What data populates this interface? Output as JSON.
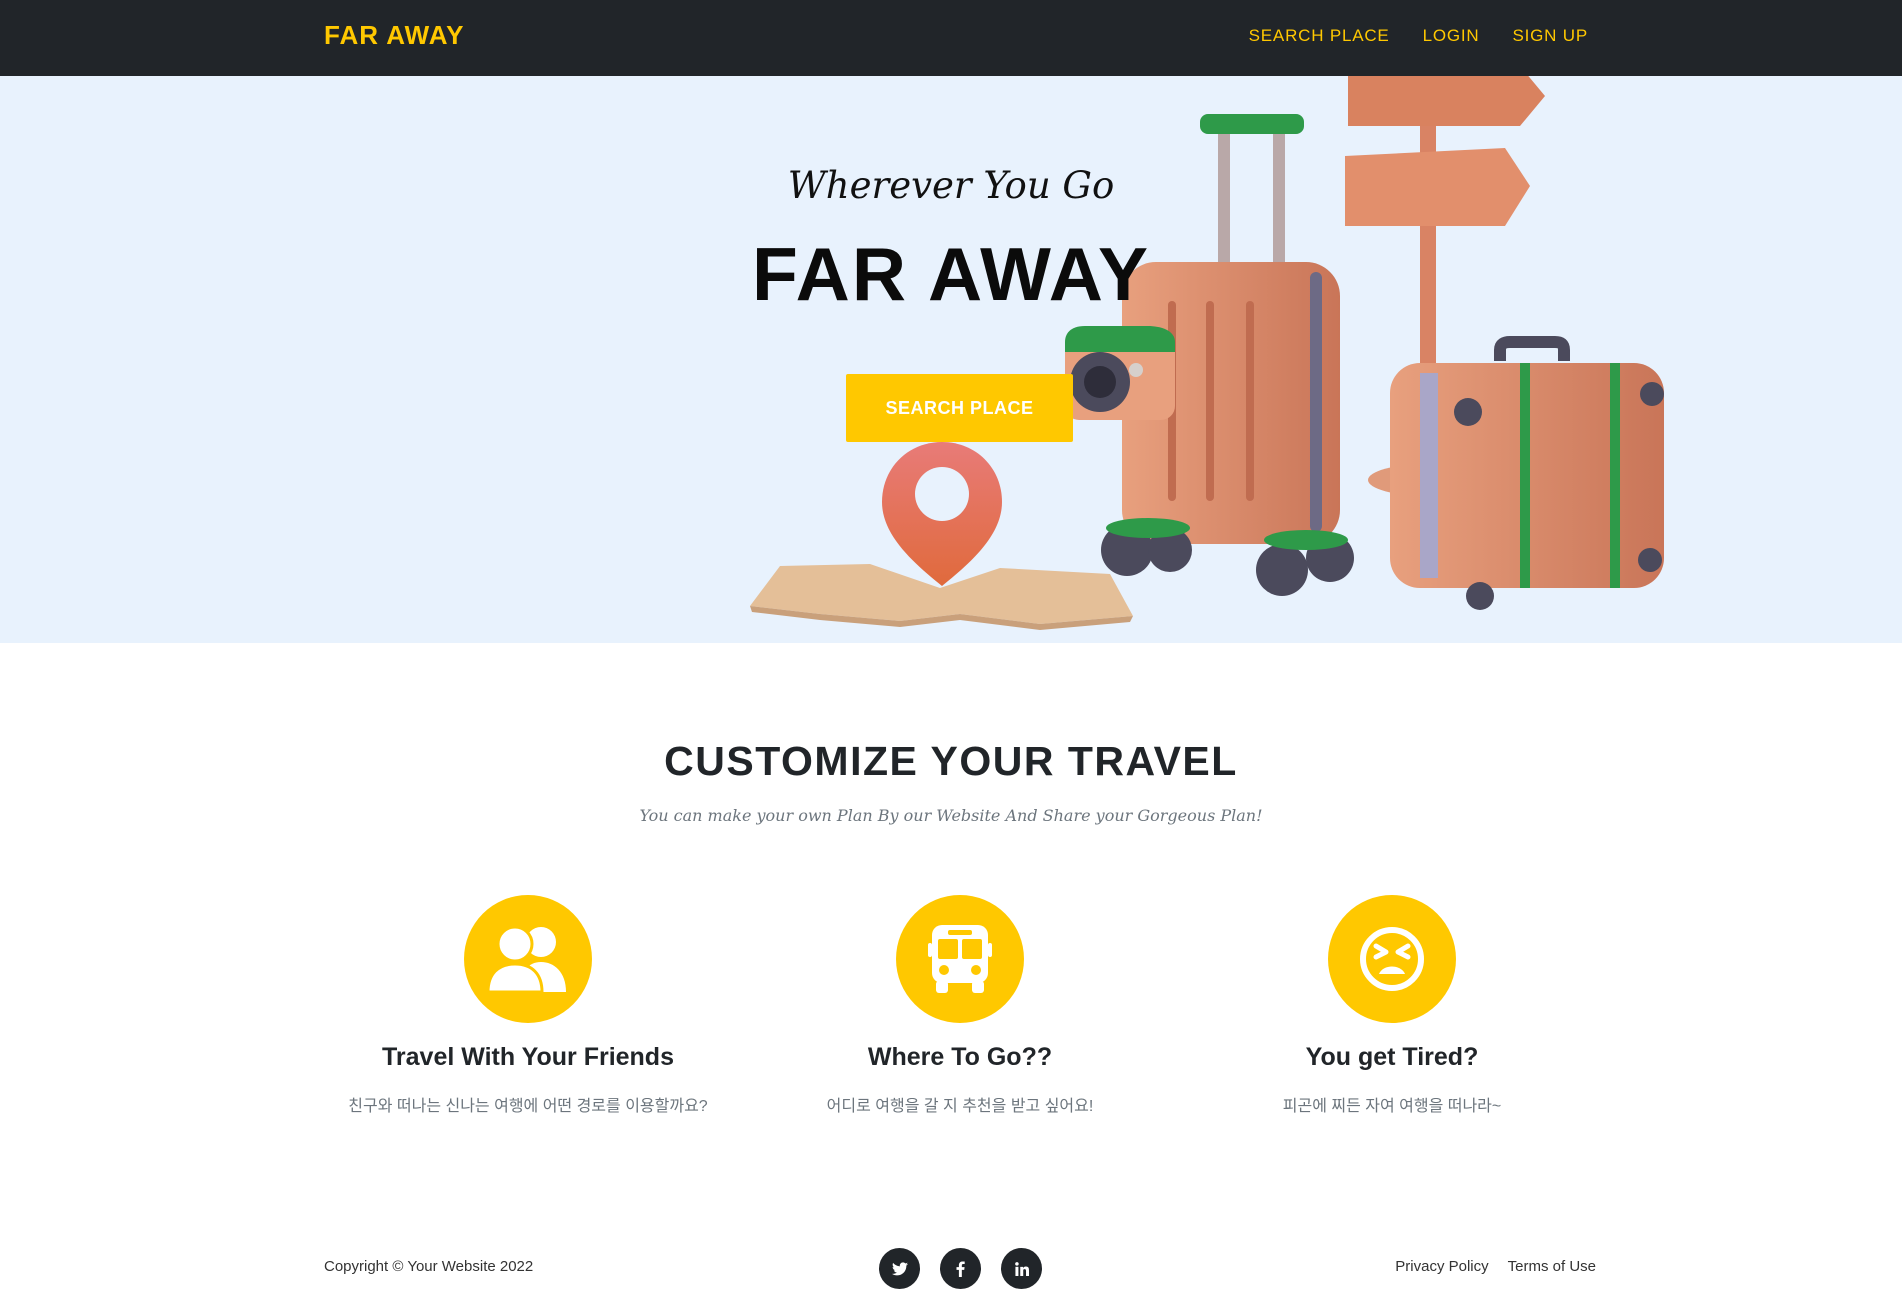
{
  "colors": {
    "accent": "#ffc800",
    "dark": "#212529",
    "hero_bg": "#e8f2fd",
    "muted": "#6c757d"
  },
  "navbar": {
    "brand": "FAR AWAY",
    "links": [
      "SEARCH PLACE",
      "LOGIN",
      "SIGN UP"
    ]
  },
  "hero": {
    "subheading": "Wherever You Go",
    "heading": "FAR AWAY",
    "button": "SEARCH PLACE"
  },
  "services": {
    "heading": "CUSTOMIZE YOUR TRAVEL",
    "subheading": "You can make your own Plan By our Website And Share your Gorgeous Plan!",
    "items": [
      {
        "icon": "users-icon",
        "title": "Travel With Your Friends",
        "text": "친구와 떠나는 신나는 여행에 어떤 경로를 이용할까요?"
      },
      {
        "icon": "bus-icon",
        "title": "Where To Go??",
        "text": "어디로 여행을 갈 지 추천을 받고 싶어요!"
      },
      {
        "icon": "tired-face-icon",
        "title": "You get Tired?",
        "text": "피곤에 찌든 자여 여행을 떠나라~"
      }
    ]
  },
  "footer": {
    "copyright": "Copyright © Your Website 2022",
    "socials": [
      {
        "icon": "twitter-icon"
      },
      {
        "icon": "facebook-icon"
      },
      {
        "icon": "linkedin-icon"
      }
    ],
    "links": [
      "Privacy Policy",
      "Terms of Use"
    ]
  }
}
